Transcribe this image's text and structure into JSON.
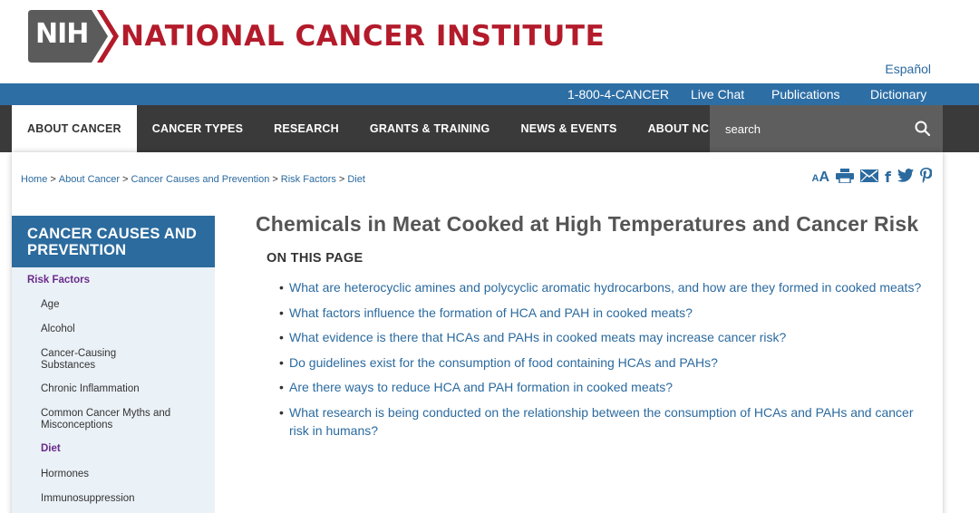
{
  "header": {
    "logo_abbr": "NIH",
    "institute_name": "NATIONAL CANCER INSTITUTE",
    "language_link": "Español"
  },
  "utility_nav": {
    "phone": "1-800-4-CANCER",
    "live_chat": "Live Chat",
    "publications": "Publications",
    "dictionary": "Dictionary"
  },
  "main_nav": {
    "items": [
      {
        "label": "ABOUT CANCER"
      },
      {
        "label": "CANCER TYPES"
      },
      {
        "label": "RESEARCH"
      },
      {
        "label": "GRANTS & TRAINING"
      },
      {
        "label": "NEWS & EVENTS"
      },
      {
        "label": "ABOUT NCI"
      }
    ],
    "search_placeholder": "search"
  },
  "breadcrumb": {
    "items": [
      "Home",
      "About Cancer",
      "Cancer Causes and Prevention",
      "Risk Factors",
      "Diet"
    ]
  },
  "tools": {
    "text_size": "AA",
    "icons": [
      "print-icon",
      "email-icon",
      "facebook-icon",
      "twitter-icon",
      "pinterest-icon"
    ]
  },
  "sidebar": {
    "heading": "CANCER CAUSES AND PREVENTION",
    "section": "Risk Factors",
    "items": [
      {
        "label": "Age"
      },
      {
        "label": "Alcohol"
      },
      {
        "label": "Cancer-Causing Substances"
      },
      {
        "label": "Chronic Inflammation"
      },
      {
        "label": "Common Cancer Myths and Misconceptions"
      },
      {
        "label": "Diet"
      },
      {
        "label": "Hormones"
      },
      {
        "label": "Immunosuppression"
      }
    ]
  },
  "article": {
    "title": "Chemicals in Meat Cooked at High Temperatures and Cancer Risk",
    "on_this_page": "ON THIS PAGE",
    "toc": [
      "What are heterocyclic amines and polycyclic aromatic hydrocarbons, and how are they formed in cooked meats?",
      "What factors influence the formation of HCA and PAH in cooked meats?",
      "What evidence is there that HCAs and PAHs in cooked meats may increase cancer risk?",
      "Do guidelines exist for the consumption of food containing HCAs and PAHs?",
      "Are there ways to reduce HCA and PAH formation in cooked meats?",
      "What research is being conducted on the relationship between the consumption of HCAs and PAHs and cancer risk in humans?"
    ]
  },
  "colors": {
    "brand_red": "#b31b2b",
    "nih_gray": "#5b5b5b",
    "utility_blue": "#2d6ea5",
    "nav_dark": "#3a3a3a",
    "link_blue": "#2b6a9f",
    "sidebar_active": "#6a2a8a"
  }
}
